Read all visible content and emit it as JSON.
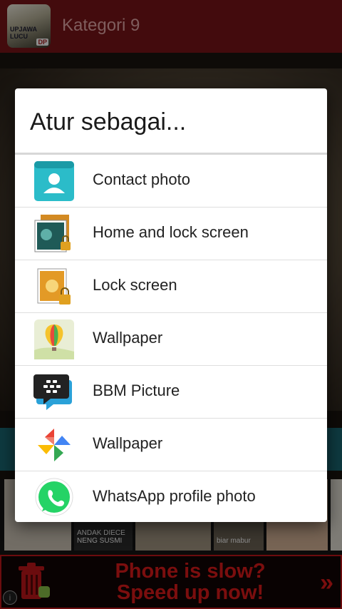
{
  "appbar": {
    "title": "Kategori 9",
    "logo_lines": [
      "UPJAWA LUCU",
      "DP"
    ]
  },
  "thumbnails": [
    {
      "caption": ""
    },
    {
      "caption": "ANDAK DIECE NENG SUSMI"
    },
    {
      "caption": ""
    },
    {
      "caption": "biar mabur"
    },
    {
      "caption": ""
    },
    {
      "caption": ""
    }
  ],
  "dialog": {
    "title": "Atur sebagai...",
    "options": [
      {
        "label": "Contact photo",
        "icon": "contact-photo-icon"
      },
      {
        "label": "Home and lock screen",
        "icon": "home-lock-screen-icon"
      },
      {
        "label": "Lock screen",
        "icon": "lock-screen-icon"
      },
      {
        "label": "Wallpaper",
        "icon": "wallpaper-balloon-icon"
      },
      {
        "label": "BBM Picture",
        "icon": "bbm-icon"
      },
      {
        "label": "Wallpaper",
        "icon": "google-photos-pinwheel-icon"
      },
      {
        "label": "WhatsApp profile photo",
        "icon": "whatsapp-icon"
      }
    ]
  },
  "ad": {
    "line1": "Phone is slow?",
    "line2": "Speed up now!",
    "arrow": "»",
    "info": "i"
  },
  "colors": {
    "appbar": "#7a1418",
    "ad_red": "#e11b1b",
    "whatsapp": "#25d366",
    "contact": "#2bbcc9"
  }
}
